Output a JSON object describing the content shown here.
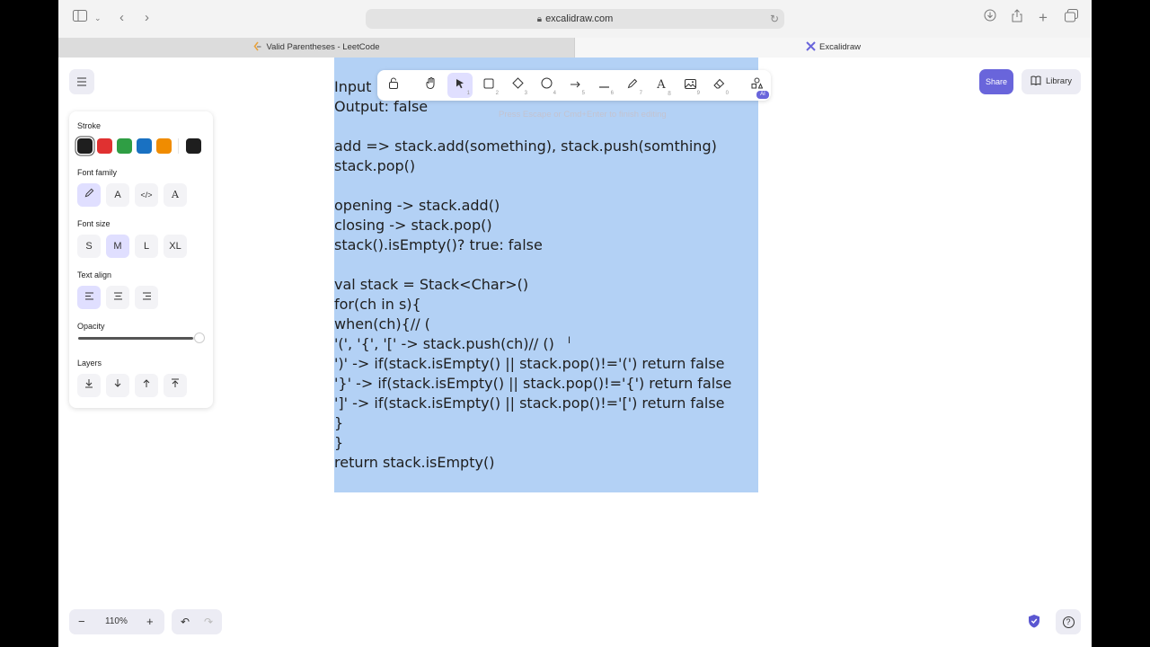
{
  "browser": {
    "url": "excalidraw.com",
    "tabs": [
      {
        "label": "Valid Parentheses - LeetCode"
      },
      {
        "label": "Excalidraw"
      }
    ]
  },
  "toolbar": {
    "tools": [
      {
        "name": "lock",
        "key": ""
      },
      {
        "name": "hand",
        "key": ""
      },
      {
        "name": "selection",
        "key": "1"
      },
      {
        "name": "rectangle",
        "key": "2"
      },
      {
        "name": "diamond",
        "key": "3"
      },
      {
        "name": "ellipse",
        "key": "4"
      },
      {
        "name": "arrow",
        "key": "5"
      },
      {
        "name": "line",
        "key": "6"
      },
      {
        "name": "draw",
        "key": "7"
      },
      {
        "name": "text",
        "key": "8"
      },
      {
        "name": "image",
        "key": "9"
      },
      {
        "name": "eraser",
        "key": "0"
      },
      {
        "name": "more-tools",
        "key": ""
      }
    ],
    "ai_badge": "AI",
    "hint": "Press Escape or Cmd+Enter to finish editing"
  },
  "header": {
    "share_label": "Share",
    "library_label": "Library"
  },
  "panel": {
    "stroke_label": "Stroke",
    "stroke_colors": [
      "#1e1e1e",
      "#e03131",
      "#2f9e44",
      "#1971c2",
      "#f08c00"
    ],
    "current_color": "#1e1e1e",
    "font_family_label": "Font family",
    "font_size_label": "Font size",
    "font_sizes": [
      "S",
      "M",
      "L",
      "XL"
    ],
    "text_align_label": "Text align",
    "opacity_label": "Opacity",
    "opacity_value": 1.0,
    "layers_label": "Layers"
  },
  "editor": {
    "lines": [
      "Input",
      "Output: false",
      "",
      "add => stack.add(something), stack.push(somthing)",
      "stack.pop()",
      "",
      "opening -> stack.add()",
      "closing -> stack.pop()",
      "stack().isEmpty()? true: false",
      "",
      "val stack = Stack<Char>()",
      "for(ch in s){",
      "when(ch){// (",
      "'(', '{', '[' -> stack.push(ch)// ()",
      "')' -> if(stack.isEmpty() || stack.pop()!='(') return false",
      "'}' -> if(stack.isEmpty() || stack.pop()!='{') return false",
      "']' -> if(stack.isEmpty() || stack.pop()!='[') return false",
      "}",
      "}",
      "return stack.isEmpty()"
    ]
  },
  "footer": {
    "zoom_label": "110%",
    "zoom_out": "−",
    "zoom_in": "+",
    "help": "?"
  }
}
